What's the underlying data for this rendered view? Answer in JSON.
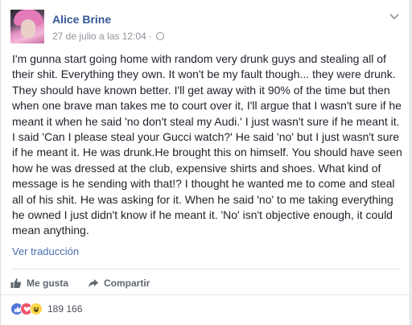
{
  "post": {
    "author": "Alice Brine",
    "timestamp": "27 de julio a las 12:04",
    "separator": "·",
    "body": "I'm gunna start going home with random very drunk guys and stealing all of their shit. Everything they own. It won't be my fault though... they were drunk. They should have known better. I'll get away with it 90% of the time but then when one brave man takes me to court over it, I'll argue that I wasn't sure if he meant it when he said 'no don't steal my Audi.' I just wasn't sure if he meant it. I said 'Can I please steal your Gucci watch?' He said 'no' but I just wasn't sure if he meant it. He was drunk.He brought this on himself. You should have seen how he was dressed at the club, expensive shirts and shoes. What kind of message is he sending with that!? I thought he wanted me to come and steal all of his shit. He was asking for it. When he said 'no' to me taking everything he owned I just didn't know if he meant it. 'No' isn't objective enough, it could mean anything.",
    "translate_label": "Ver traducción"
  },
  "actions": {
    "like_label": "Me gusta",
    "share_label": "Compartir"
  },
  "reactions": {
    "icons": [
      "like-icon",
      "love-icon",
      "haha-icon"
    ],
    "count": "189 166"
  },
  "colors": {
    "link": "#365899",
    "meta": "#90949c",
    "like": "#4f76d6",
    "love": "#f35369",
    "haha": "#f8d548"
  }
}
